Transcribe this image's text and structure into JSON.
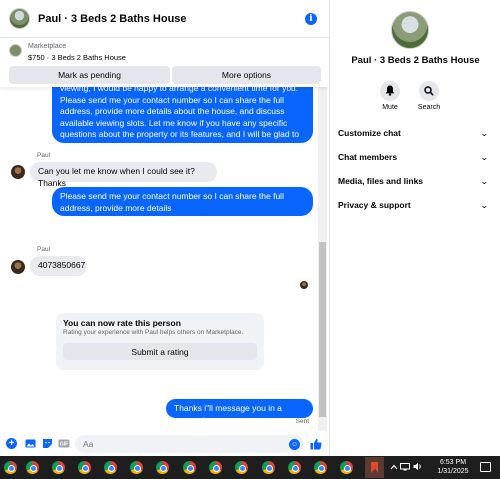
{
  "chat": {
    "title": "Paul · 3 Beds 2 Baths House",
    "info_icon": "i"
  },
  "listing": {
    "category": "Marketplace",
    "price_title": "$750 · 3 Beds 2 Baths House",
    "mark_pending_label": "Mark as pending",
    "more_options_label": "More options"
  },
  "messages": {
    "outgoing_1": "viewing, I would be happy to arrange a convenient time for you. Please send me your contact number so I can share the full address, provide more details about the house, and discuss available viewing slots. Let me know if you have any specific questions about the property or its features, and I will be glad to assist you",
    "sender_1": "Paul",
    "incoming_1": "Can you let me know when I could see it? Thanks",
    "outgoing_2": "Please send me your contact number so I can share the full address, provide more details",
    "sender_2": "Paul",
    "incoming_2": "4073850667",
    "outgoing_3": "Thanks i\"ll message you in a moment",
    "sent_status": "Sent"
  },
  "rating": {
    "title": "You can now rate this person",
    "subtitle": "Rating your experience with Paul helps others on Marketplace.",
    "button_label": "Submit a rating"
  },
  "composer": {
    "placeholder": "Aa",
    "icons": [
      "plus-icon",
      "image-icon",
      "sticker-icon",
      "gif-icon",
      "emoji-icon",
      "like-icon"
    ]
  },
  "panel": {
    "name": "Paul · 3 Beds 2 Baths House",
    "mute_label": "Mute",
    "search_label": "Search",
    "rows": [
      "Customize chat",
      "Chat members",
      "Media, files and links",
      "Privacy & support"
    ]
  },
  "taskbar": {
    "time": "6:53 PM",
    "date": "1/31/2025",
    "pinned_count": 13
  },
  "colors": {
    "accent": "#0866ff",
    "bubble_in": "#e9eaed",
    "taskbar": "#1e1e1e"
  }
}
